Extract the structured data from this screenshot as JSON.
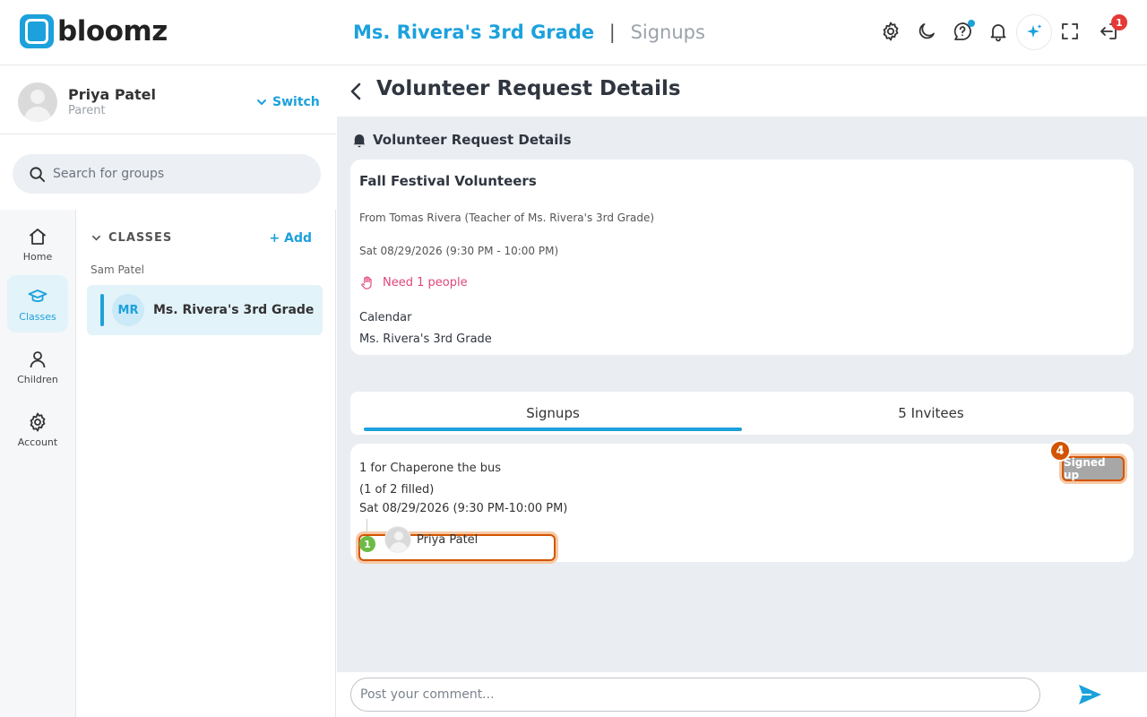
{
  "app": {
    "name": "bloomz"
  },
  "header": {
    "class_name": "Ms. Rivera's 3rd Grade",
    "separator": "|",
    "section": "Signups",
    "notification_count": "1"
  },
  "profile": {
    "name": "Priya Patel",
    "role": "Parent",
    "switch_label": "Switch"
  },
  "search": {
    "placeholder": "Search for groups"
  },
  "nav": {
    "items": [
      {
        "label": "Home",
        "icon": "home-icon"
      },
      {
        "label": "Classes",
        "icon": "graduation-cap-icon"
      },
      {
        "label": "Children",
        "icon": "person-icon"
      },
      {
        "label": "Account",
        "icon": "gear-icon"
      }
    ],
    "active": "Classes"
  },
  "classes": {
    "heading": "CLASSES",
    "add_label": "Add",
    "child_label": "Sam Patel",
    "items": [
      {
        "initials": "MR",
        "name": "Ms. Rivera's 3rd Grade"
      }
    ]
  },
  "page": {
    "title": "Volunteer Request Details"
  },
  "detail": {
    "section_title": "Volunteer Request Details",
    "event_title": "Fall Festival Volunteers",
    "from": "From Tomas Rivera (Teacher of Ms. Rivera's 3rd Grade)",
    "date": "Sat 08/29/2026 (9:30 PM - 10:00 PM)",
    "need": "Need 1 people",
    "calendar_label": "Calendar",
    "calendar_value": "Ms. Rivera's 3rd Grade"
  },
  "tabs": {
    "signups": "Signups",
    "invitees": "5 Invitees",
    "active": "Signups"
  },
  "slot": {
    "title": "1 for Chaperone the bus",
    "filled": "(1 of 2 filled)",
    "date": "Sat 08/29/2026 (9:30 PM-10:00 PM)",
    "button_label": "Signed up",
    "attendee": "Priya Patel",
    "step_button": "4",
    "step_attendee": "1"
  },
  "comment": {
    "placeholder": "Post your comment..."
  },
  "colors": {
    "brand": "#1ca1dc",
    "need": "#e0457b",
    "highlight": "#d35400",
    "notification": "#e53935"
  }
}
